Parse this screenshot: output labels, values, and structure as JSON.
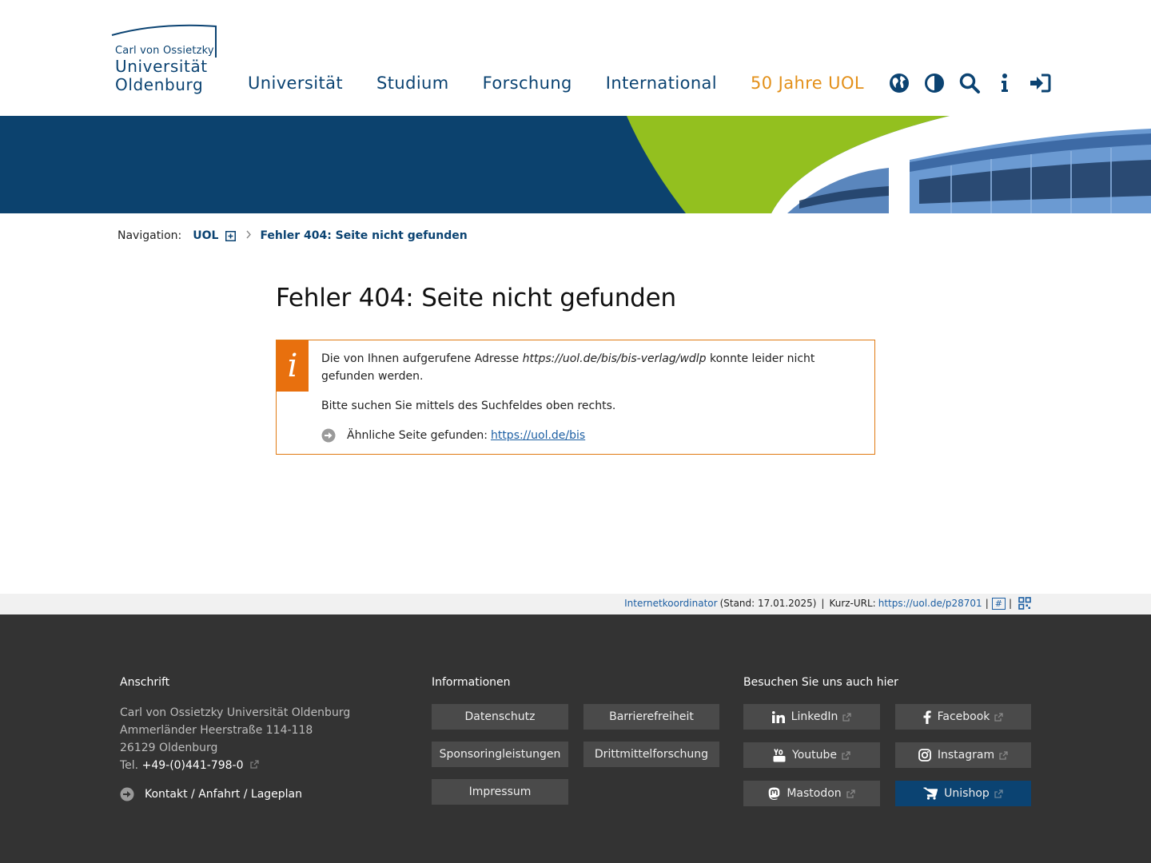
{
  "header": {
    "logo": {
      "line1": "Carl von Ossietzky",
      "line2": "Universität",
      "line3": "Oldenburg"
    },
    "nav": [
      {
        "label": "Universität"
      },
      {
        "label": "Studium"
      },
      {
        "label": "Forschung"
      },
      {
        "label": "International"
      },
      {
        "label": "50 Jahre UOL"
      }
    ],
    "tools": [
      "globe-icon",
      "contrast-icon",
      "search-icon",
      "info-icon",
      "login-icon"
    ]
  },
  "breadcrumb": {
    "label": "Navigation:",
    "root": "UOL",
    "current": "Fehler 404: Seite nicht gefunden"
  },
  "content": {
    "title": "Fehler 404: Seite nicht gefunden",
    "info_badge": "i",
    "msg_part1": "Die von Ihnen aufgerufene Adresse ",
    "msg_url": "https://uol.de/bis/bis-verlag/wdlp",
    "msg_part2": " konnte leider nicht gefunden werden.",
    "search_hint": "Bitte suchen Sie mittels des Suchfeldes oben rechts.",
    "similar_label": "Ähnliche Seite gefunden:",
    "similar_link": "https://uol.de/bis"
  },
  "meta": {
    "coordinator": "Internetkoordinator",
    "stand": "(Stand: 17.01.2025)",
    "sep": "|",
    "kurz_label": "Kurz-URL:",
    "kurz_url": "https://uol.de/p28701",
    "hash": "#"
  },
  "footer": {
    "address_heading": "Anschrift",
    "address_lines": [
      "Carl von Ossietzky Universität Oldenburg",
      "Ammerländer Heerstraße 114-118",
      "26129 Oldenburg"
    ],
    "tel_label": "Tel.",
    "tel": "+49-(0)441-798-0",
    "contact_link": "Kontakt / Anfahrt / Lageplan",
    "info_heading": "Informationen",
    "info_links": [
      "Datenschutz",
      "Barrierefreiheit",
      "Sponsoringleistungen",
      "Drittmittelforschung",
      "Impressum"
    ],
    "social_heading": "Besuchen Sie uns auch hier",
    "social": [
      {
        "label": "LinkedIn",
        "icon": "linkedin-icon"
      },
      {
        "label": "Facebook",
        "icon": "facebook-icon"
      },
      {
        "label": "Youtube",
        "icon": "youtube-icon"
      },
      {
        "label": "Instagram",
        "icon": "instagram-icon"
      },
      {
        "label": "Mastodon",
        "icon": "mastodon-icon"
      },
      {
        "label": "Unishop",
        "icon": "cart-icon"
      }
    ]
  },
  "colors": {
    "brand_blue": "#0b4372",
    "accent_orange": "#e3901a",
    "info_orange": "#e8700e",
    "banner_green": "#93c01f",
    "footer_bg": "#333333",
    "link_blue": "#1d5fa3"
  }
}
